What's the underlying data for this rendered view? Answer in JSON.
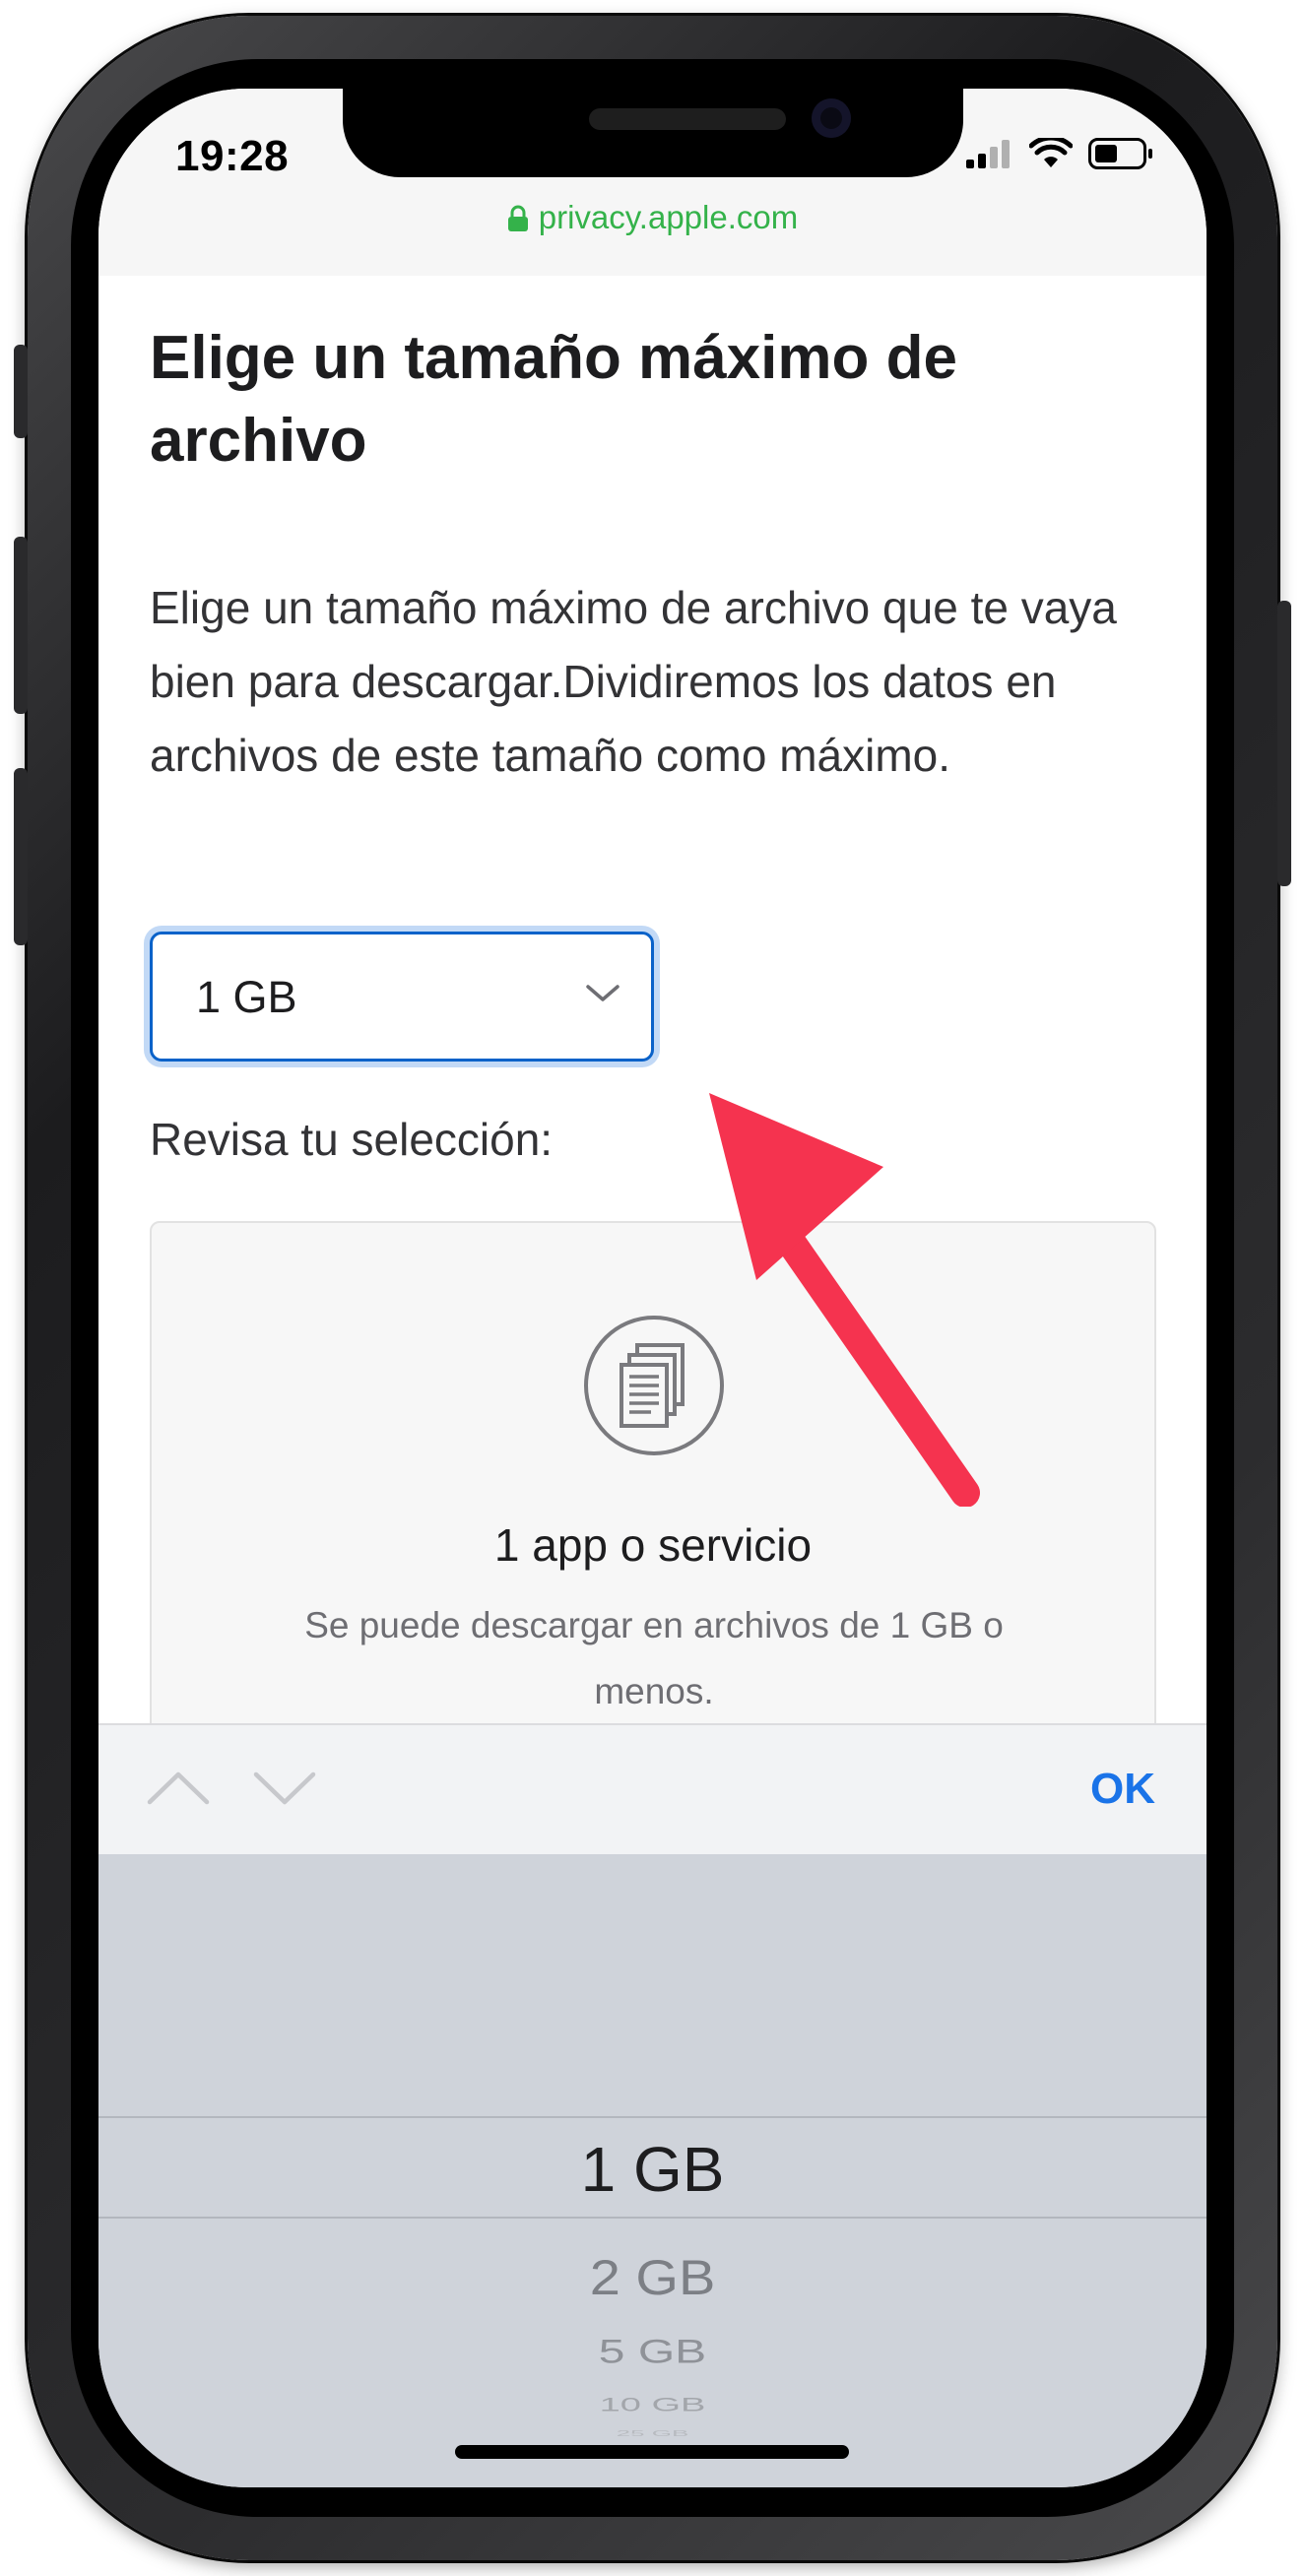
{
  "status_bar": {
    "time": "19:28",
    "icons": [
      "signal-icon",
      "wifi-icon",
      "battery-icon"
    ]
  },
  "browser": {
    "url": "privacy.apple.com",
    "lock_icon": "lock-icon",
    "url_color": "#34b24a"
  },
  "page": {
    "title": "Elige un tamaño máximo de archivo",
    "description": "Elige un tamaño máximo de archivo que te vaya bien para descargar.Dividiremos los datos en archivos de este tamaño como máximo.",
    "select": {
      "value": "1 GB",
      "chevron_icon": "chevron-down-icon",
      "focus_color": "#0a62c9"
    },
    "review_label": "Revisa tu selección:",
    "summary": {
      "icon": "documents-icon",
      "title": "1 app o servicio",
      "description": "Se puede descargar en archivos de 1 GB o menos."
    }
  },
  "annotation": {
    "arrow_color": "#f5334f"
  },
  "accessory_bar": {
    "up_icon": "chevron-up-icon",
    "down_icon": "chevron-down-icon",
    "ok_label": "OK",
    "ok_color": "#1a73e8"
  },
  "picker": {
    "options": [
      "1 GB",
      "2 GB",
      "5 GB",
      "10 GB",
      "25 GB"
    ],
    "selected": "1 GB"
  }
}
